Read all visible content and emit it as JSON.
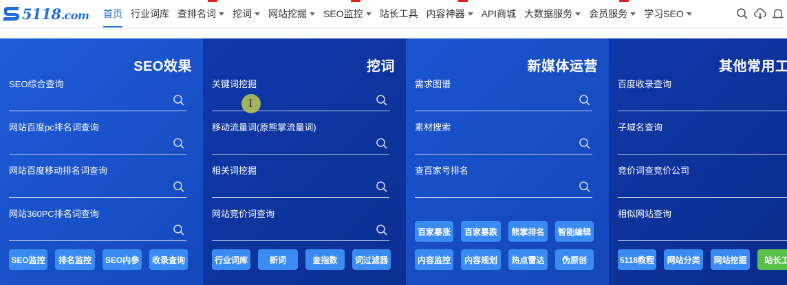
{
  "logo": {
    "main": "5118",
    "suffix": ".com"
  },
  "nav": [
    {
      "label": "首页",
      "active": true,
      "dropdown": false
    },
    {
      "label": "行业词库",
      "dropdown": false
    },
    {
      "label": "查排名词",
      "dropdown": true
    },
    {
      "label": "挖词",
      "dropdown": true
    },
    {
      "label": "网站挖掘",
      "dropdown": true
    },
    {
      "label": "SEO监控",
      "dropdown": true
    },
    {
      "label": "站长工具",
      "dropdown": false
    },
    {
      "label": "内容神器",
      "dropdown": true
    },
    {
      "label": "API商城",
      "dropdown": false
    },
    {
      "label": "大数据服务",
      "dropdown": true
    },
    {
      "label": "会员服务",
      "dropdown": true
    },
    {
      "label": "学习SEO",
      "dropdown": true
    }
  ],
  "nav_icons": [
    "search-icon",
    "cloud-download-icon",
    "bell-icon"
  ],
  "colors": {
    "accent": "#1e6fd9",
    "button": "#3b8cf2",
    "button_green": "#5bc04a"
  },
  "panels": [
    {
      "title": "SEO效果",
      "fields": [
        "SEO综合查询",
        "网站百度pc排名词查询",
        "网站百度移动排名词查询",
        "网站360PC排名词查询"
      ],
      "buttons": [
        [
          "SEO监控",
          "排名监控",
          "SEO内参",
          "收录查询"
        ]
      ]
    },
    {
      "title": "挖词",
      "fields": [
        "关键词挖掘",
        "移动流量词(原熊掌流量词)",
        "相关词挖掘",
        "网站竞价词查询"
      ],
      "buttons": [
        [
          "行业词库",
          "新词",
          "查指数",
          "词过滤器"
        ]
      ]
    },
    {
      "title": "新媒体运营",
      "fields": [
        "需求图谱",
        "素材搜索",
        "查百家号排名"
      ],
      "buttons": [
        [
          "百家暴涨",
          "百家暴跌",
          "熊掌排名",
          "智能编辑"
        ],
        [
          "内容监控",
          "内容规划",
          "热点雷达",
          "伪原创"
        ]
      ]
    },
    {
      "title": "其他常用工具",
      "fields": [
        "百度收录查询",
        "子域名查询",
        "竞价词查竞价公司",
        "相似网站查询"
      ],
      "buttons": [
        [
          "5118教程",
          "网站分类",
          "网站挖掘",
          "站长工具"
        ]
      ]
    }
  ]
}
